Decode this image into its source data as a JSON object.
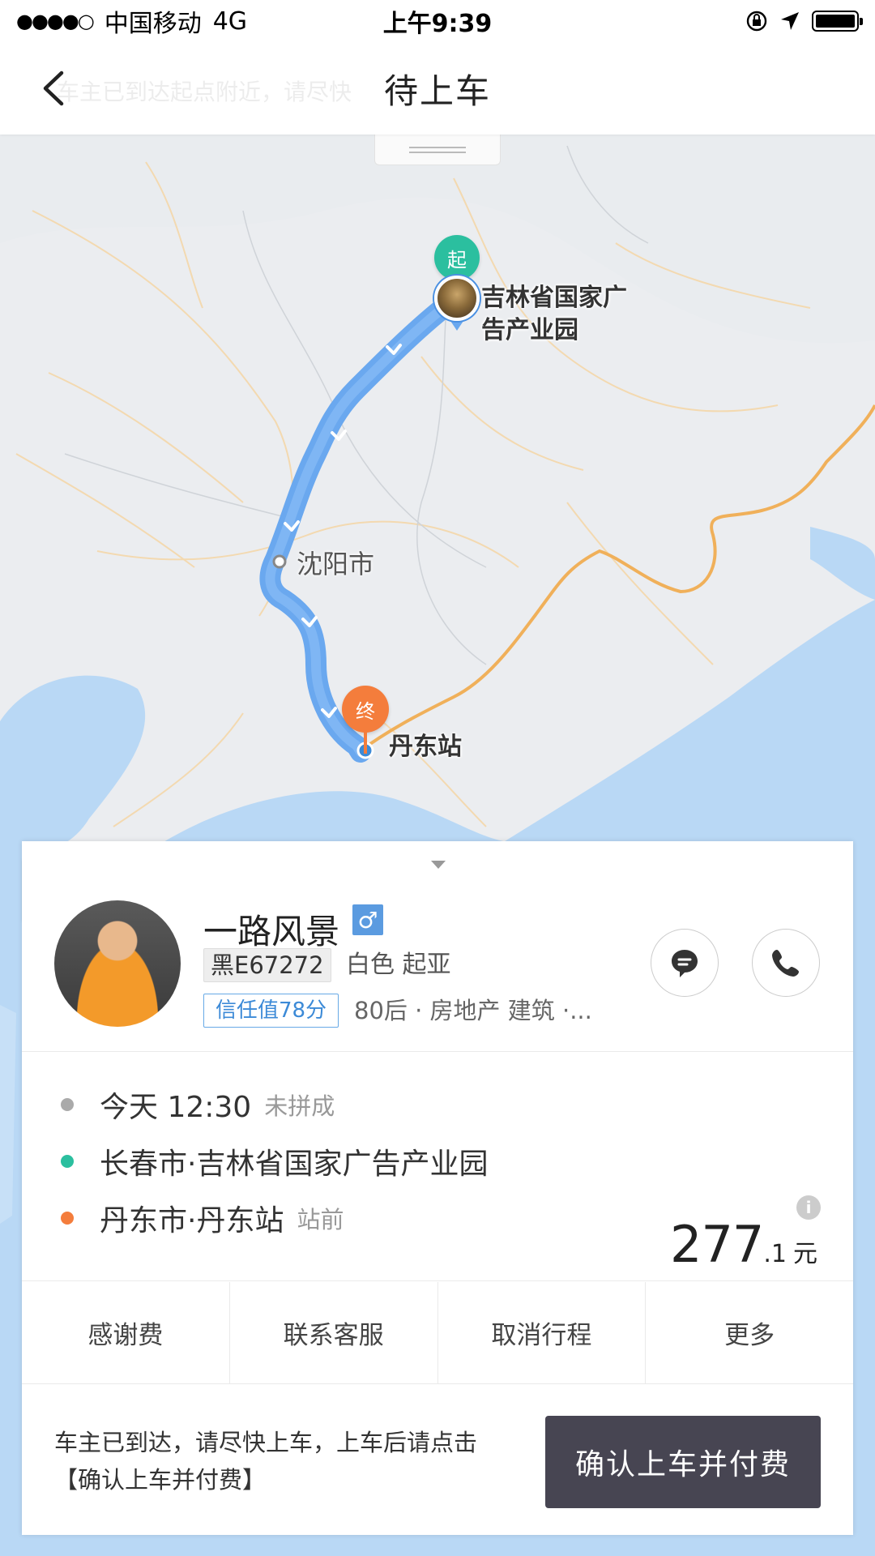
{
  "status_bar": {
    "carrier": "中国移动",
    "network": "4G",
    "time": "上午9:39"
  },
  "nav": {
    "title": "待上车",
    "ghost_text": "车主已到达起点附近，请尽快"
  },
  "map": {
    "start_pin_label": "起",
    "end_pin_label": "终",
    "start_place": "吉林省国家广告产业园",
    "end_place": "丹东站",
    "city": "沈阳市"
  },
  "driver": {
    "name": "一路风景",
    "gender_symbol": "♂",
    "plate": "黑E67272",
    "car": "白色 起亚",
    "trust": "信任值78分",
    "tags": "80后 · 房地产 建筑 ·..."
  },
  "trip": {
    "time": "今天 12:30",
    "time_note": "未拼成",
    "start": "长春市·吉林省国家广告产业园",
    "end": "丹东市·丹东站",
    "end_note": "站前",
    "price_int": "277",
    "price_dec": ".1",
    "price_unit": "元"
  },
  "actions": [
    "感谢费",
    "联系客服",
    "取消行程",
    "更多"
  ],
  "footer": {
    "notice": "车主已到达，请尽快上车，上车后请点击【确认上车并付费】",
    "confirm_label": "确认上车并付费"
  },
  "colors": {
    "route": "#6aa8ef",
    "start": "#2bbf9f",
    "end": "#f47d3c",
    "border": "#f0b05a",
    "water": "#b9d8f5",
    "button": "#474552"
  }
}
